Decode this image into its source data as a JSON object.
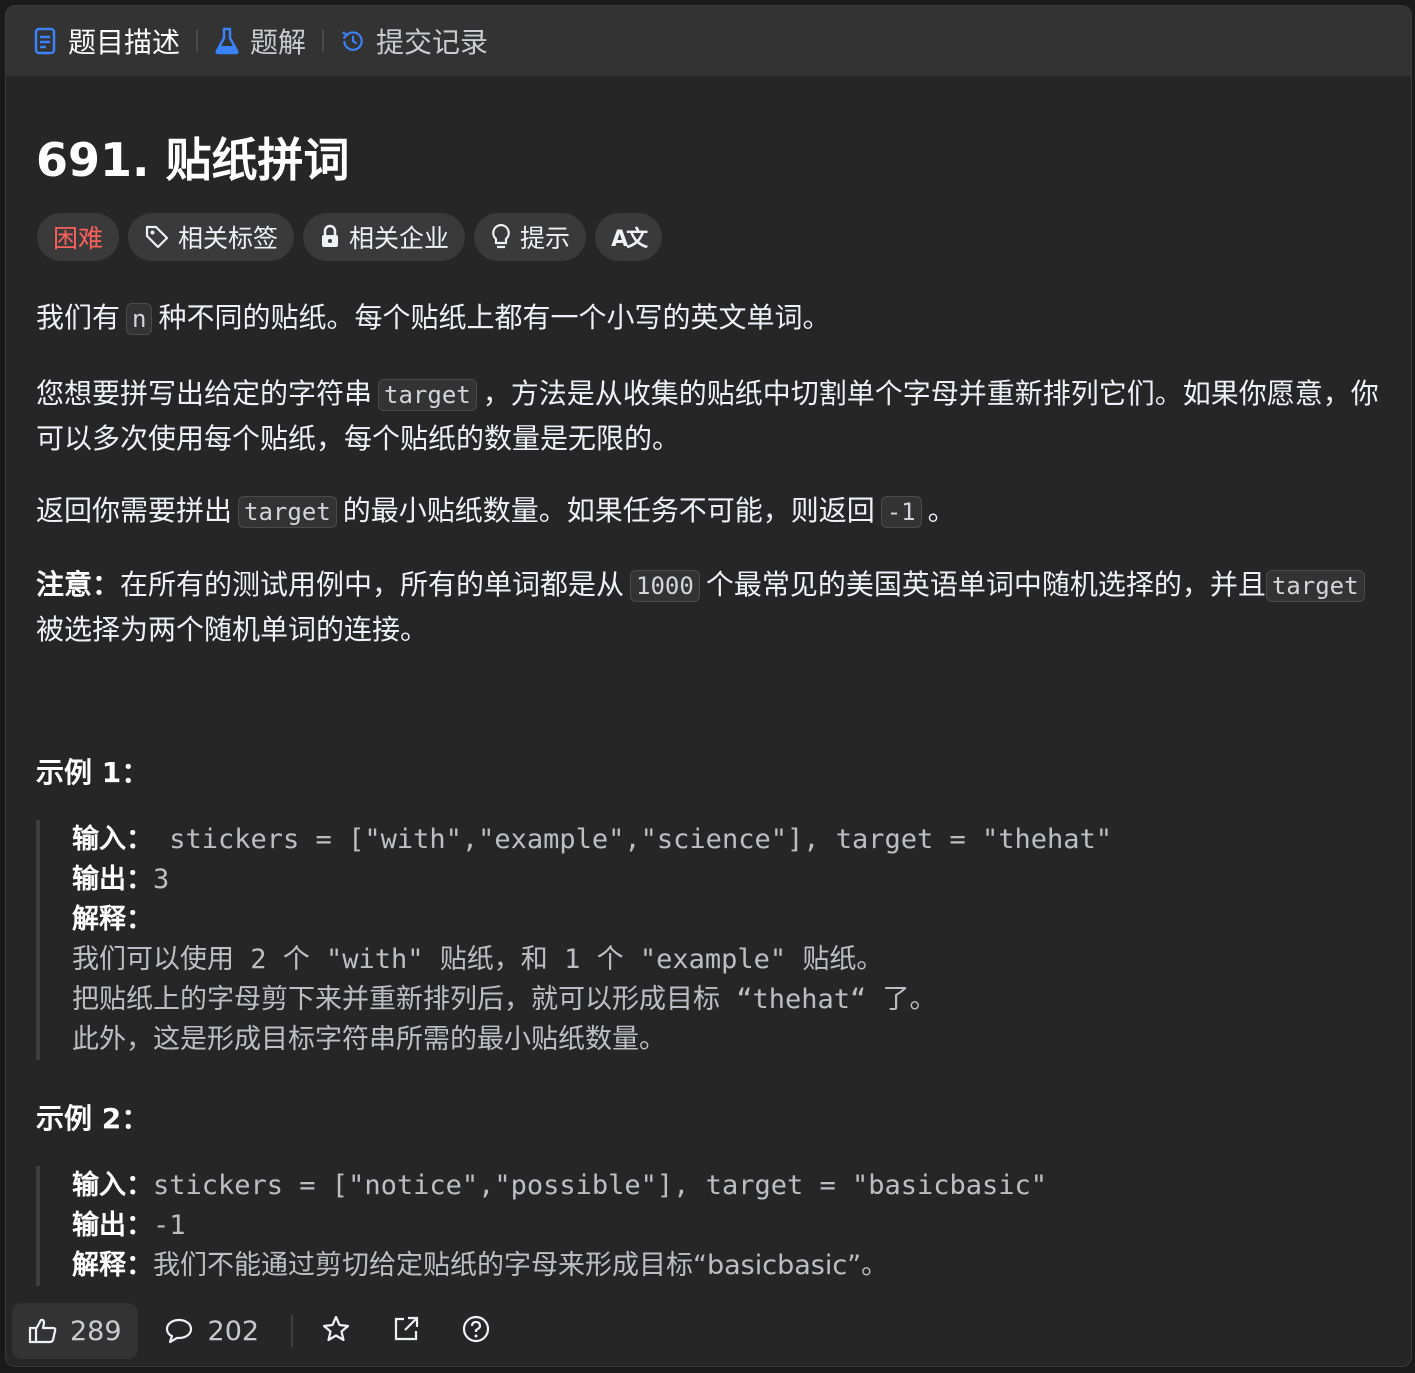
{
  "tabs": [
    {
      "label": "题目描述",
      "icon": "description-icon",
      "color": "#3b82f6"
    },
    {
      "label": "题解",
      "icon": "flask-icon",
      "color": "#3b82f6"
    },
    {
      "label": "提交记录",
      "icon": "history-icon",
      "color": "#3b82f6"
    }
  ],
  "problem": {
    "title": "691. 贴纸拼词"
  },
  "tags": {
    "difficulty": "困难",
    "related_tags": "相关标签",
    "related_companies": "相关企业",
    "hint": "提示",
    "translate": "A文"
  },
  "description": {
    "p1_a": "我们有",
    "p1_code": "n",
    "p1_b": "种不同的贴纸。每个贴纸上都有一个小写的英文单词。",
    "p2_a": "您想要拼写出给定的字符串",
    "p2_code": "target",
    "p2_b": "，方法是从收集的贴纸中切割单个字母并重新排列它们。如果你愿意，你可以多次使用每个贴纸，每个贴纸的数量是无限的。",
    "p3_a": "返回你需要拼出",
    "p3_code1": "target",
    "p3_b": "的最小贴纸数量。如果任务不可能，则返回",
    "p3_code2": "-1",
    "p3_c": "。",
    "p4_label": "注意：",
    "p4_a": "在所有的测试用例中，所有的单词都是从",
    "p4_code1": "1000",
    "p4_b": "个最常见的美国英语单词中随机选择的，并且",
    "p4_code2": "target",
    "p4_c": "被选择为两个随机单词的连接。"
  },
  "examples": [
    {
      "title": "示例 1：",
      "input_label": "输入：",
      "input": " stickers = [\"with\",\"example\",\"science\"], target = \"thehat\"",
      "output_label": "输出：",
      "output": "3",
      "explain_label": "解释：",
      "explain_lines": [
        "我们可以使用 2 个 \"with\" 贴纸，和 1 个 \"example\" 贴纸。",
        "把贴纸上的字母剪下来并重新排列后，就可以形成目标 “thehat“ 了。",
        "此外，这是形成目标字符串所需的最小贴纸数量。"
      ]
    },
    {
      "title": "示例 2：",
      "input_label": "输入：",
      "input": "stickers = [\"notice\",\"possible\"], target = \"basicbasic\"",
      "output_label": "输出：",
      "output": "-1",
      "explain_label": "解释：",
      "explain": "我们不能通过剪切给定贴纸的字母来形成目标“basicbasic”。"
    }
  ],
  "footer": {
    "likes": "289",
    "comments": "202",
    "icons": [
      "thumbs-up-icon",
      "comment-icon",
      "star-icon",
      "share-icon",
      "help-icon"
    ]
  },
  "colors": {
    "difficulty_hard": "#f8615c",
    "accent_blue": "#3b82f6",
    "panel_bg": "#262626"
  }
}
